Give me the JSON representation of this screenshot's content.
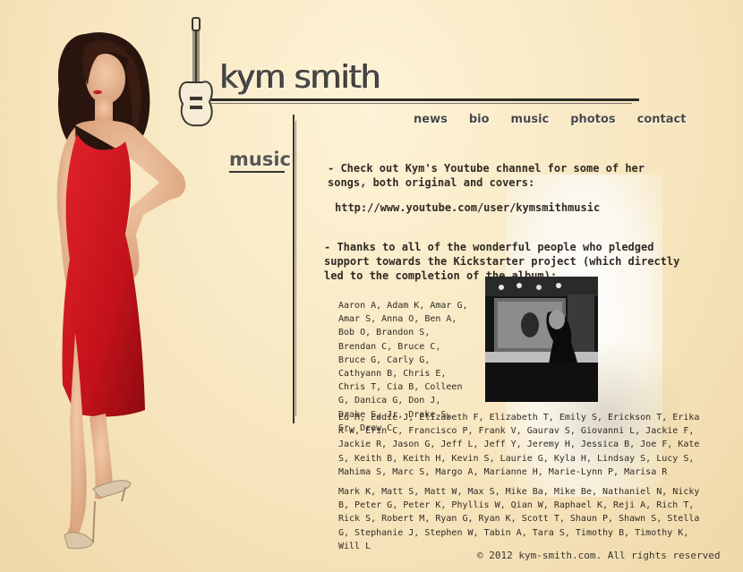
{
  "logo": {
    "text": "kym smith"
  },
  "nav": [
    {
      "label": "news"
    },
    {
      "label": "bio"
    },
    {
      "label": "music"
    },
    {
      "label": "photos"
    },
    {
      "label": "contact"
    }
  ],
  "section": {
    "title": "music"
  },
  "content": {
    "youtube_text": "- Check out Kym's Youtube channel for some of her songs, both original and covers:",
    "youtube_url": "http://www.youtube.com/user/kymsmithmusic",
    "thanks_text": "- Thanks to all of the wonderful people who pledged support towards the Kickstarter project (which directly led to the completion of the album):",
    "names_block1": "Aaron A, Adam K, Amar G, Amar S, Anna O, Ben A, Bob O, Brandon S, Brendan C, Bruce C, Bruce G, Carly G, Cathyann B, Chris E, Chris T, Cia B, Colleen G, Danica G, Don J, Drake S, Jr, Drake S, Sr, Drew C",
    "names_block2": "Ed H, Eddie J, Elizabeth F, Elizabeth T, Emily S, Erickson T, Erika K-W, Erin C, Francisco P, Frank V, Gaurav S, Giovanni L, Jackie F, Jackie R, Jason G, Jeff L, Jeff Y, Jeremy H, Jessica B, Joe F, Kate S, Keith B, Keith H, Kevin S, Laurie G, Kyla H, Lindsay S, Lucy S, Mahima S, Marc S, Margo A, Marianne H, Marie-Lynn P, Marisa R",
    "names_block3": "Mark K, Matt S, Matt W, Max S, Mike Ba, Mike Be, Nathaniel N, Nicky B, Peter G, Peter K, Phyllis W, Qian W, Raphael K, Reji A, Rich T, Rick S, Robert M, Ryan G, Ryan K, Scott T, Shaun P, Shawn S, Stella G, Stephanie J, Stephen W, Tabin A, Tara S, Timothy B, Timothy K, Will L"
  },
  "footer": {
    "copyright": "© 2012 kym-smith.com. All rights reserved"
  },
  "colors": {
    "background": "#f7e6bf",
    "dress": "#d2141a",
    "text": "#2f2a25"
  }
}
